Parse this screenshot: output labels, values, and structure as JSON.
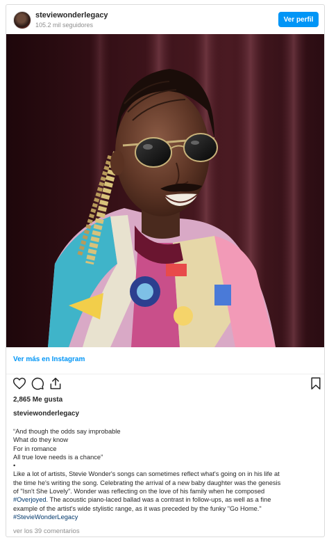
{
  "header": {
    "username": "steviewonderlegacy",
    "followers": "105.2 mil seguidores",
    "view_profile_label": "Ver perfil"
  },
  "post": {
    "view_more_label": "Ver más en Instagram",
    "likes": "2,865 Me gusta",
    "caption_username": "steviewonderlegacy",
    "caption_lines": [
      "“And though the odds say improbable",
      "What do they know",
      "For in romance",
      "All true love needs is a chance”",
      "•",
      "Like a lot of artists, Stevie Wonder's songs can sometimes reflect what's going on in his life at",
      "the time he's writing the song. Celebrating the arrival of a new baby daughter was the genesis",
      "of \"Isn't She Lovely\". Wonder was reflecting on the love of his family when he composed"
    ],
    "hashtag_overjoyed": "#Overjoyed",
    "caption_after_hashtag": ". The acoustic piano-laced ballad was a contrast in follow-ups, as well as a fine",
    "caption_line_10": "example of the artist's wide stylistic range, as it was preceded by the funky \"Go Home.\"",
    "hashtag_legacy": "#StevieWonderLegacy",
    "comments_label": "ver los 39 comentarios"
  },
  "icons": {
    "like": "heart-icon",
    "comment": "comment-icon",
    "share": "share-icon",
    "save": "bookmark-icon"
  },
  "colors": {
    "accent": "#0095f6",
    "hashtag": "#00376b",
    "muted": "#8e8e8e"
  }
}
